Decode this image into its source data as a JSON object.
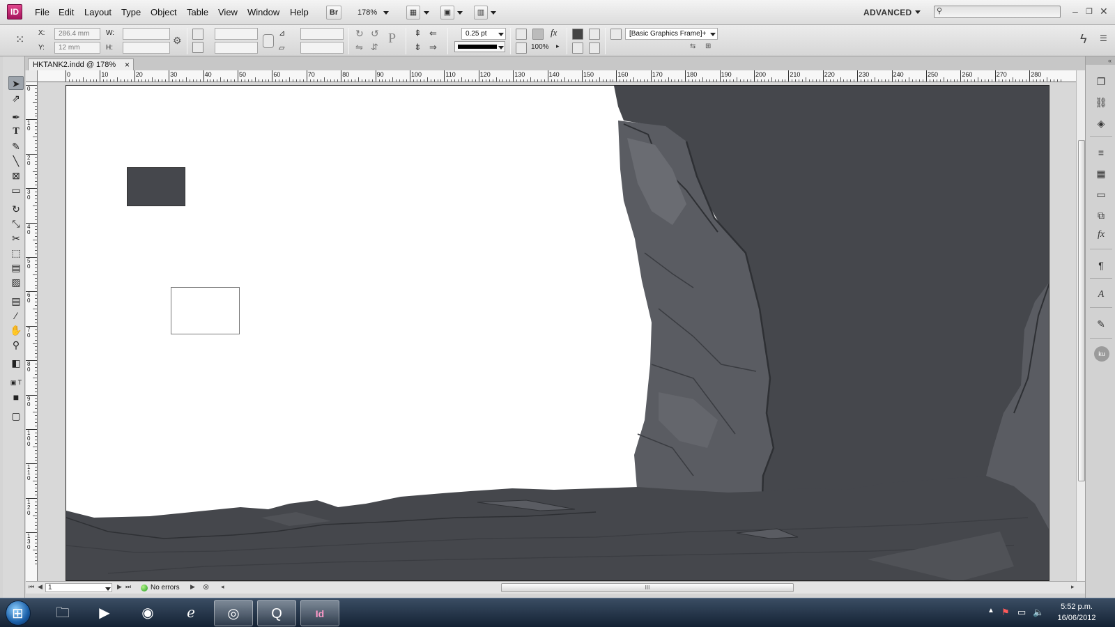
{
  "app": {
    "logo": "ID",
    "workspace": "ADVANCED",
    "zoom": "178%",
    "bridge_label": "Br"
  },
  "menu": [
    "File",
    "Edit",
    "Layout",
    "Type",
    "Object",
    "Table",
    "View",
    "Window",
    "Help"
  ],
  "control": {
    "x_label": "X:",
    "x_value": "286.4 mm",
    "y_label": "Y:",
    "y_value": "12 mm",
    "w_label": "W:",
    "w_value": "",
    "h_label": "H:",
    "h_value": "",
    "stroke_weight": "0.25 pt",
    "opacity": "100%",
    "object_style": "[Basic Graphics Frame]+"
  },
  "document": {
    "tab_title": "HKTANK2.indd @ 178%",
    "tab_close": "×"
  },
  "ruler": {
    "horizontal": [
      "0",
      "10",
      "20",
      "30",
      "40",
      "50",
      "60",
      "70",
      "80",
      "90",
      "100",
      "110",
      "120",
      "130",
      "140",
      "150",
      "160",
      "170",
      "180",
      "190",
      "200",
      "210",
      "220",
      "230",
      "240",
      "250",
      "260",
      "270",
      "280"
    ],
    "vertical": [
      "0",
      "1 0",
      "2 0",
      "3 0",
      "4 0",
      "5 0",
      "6 0",
      "7 0",
      "8 0",
      "9 0",
      "1 0 0",
      "1 1 0",
      "1 2 0",
      "1 3 0"
    ]
  },
  "status": {
    "page": "1",
    "preflight": "No errors",
    "h_scroll_grip": "III"
  },
  "taskbar": {
    "time": "5:52 p.m.",
    "date": "16/06/2012"
  },
  "colors": {
    "accent": "#a4135c",
    "artwork_dark": "#45474c",
    "artwork_mid": "#5a5c62",
    "preflight_ok": "#1a9a1a"
  }
}
